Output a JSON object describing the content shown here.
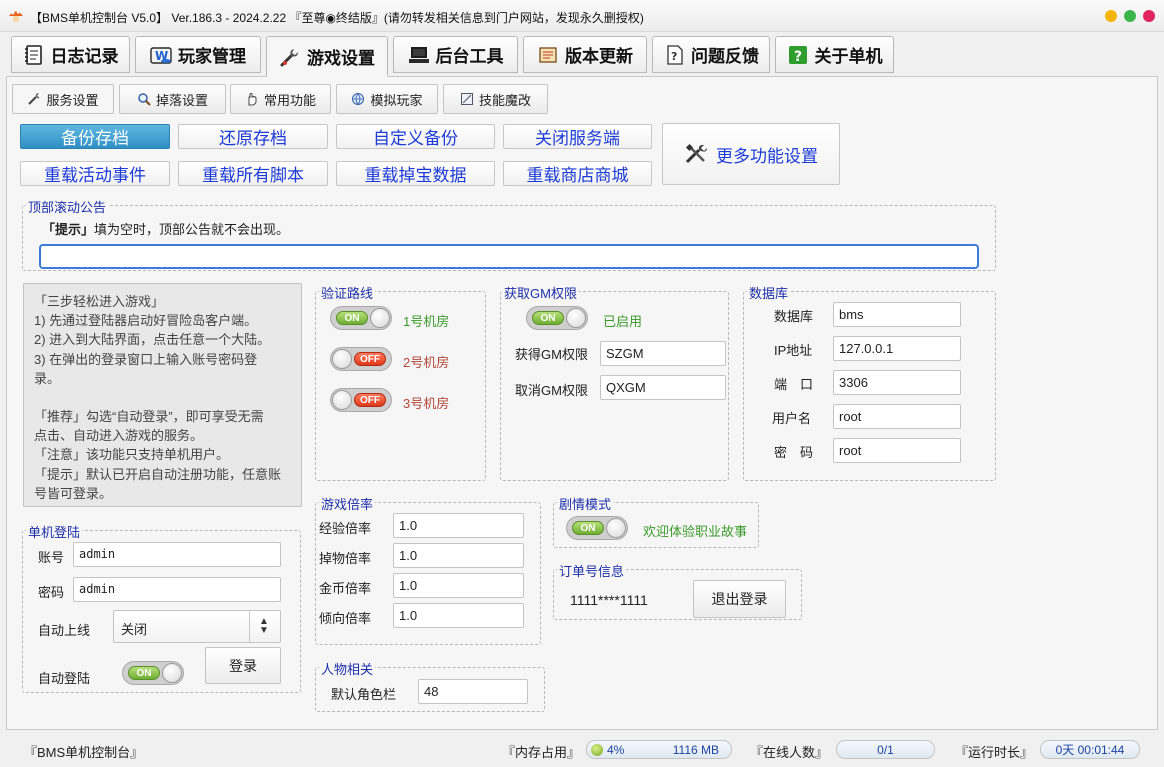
{
  "window": {
    "title": "【BMS单机控制台 V5.0】 Ver.186.3 - 2024.2.22 『至尊◉终结版』(请勿转发相关信息到门户网站，发现永久删授权)",
    "traffic_colors": [
      "#f5b400",
      "#3cb54a",
      "#e0245e"
    ]
  },
  "main_tabs": [
    {
      "label": "日志记录",
      "icon": "notebook-icon"
    },
    {
      "label": "玩家管理",
      "icon": "web-player-icon"
    },
    {
      "label": "游戏设置",
      "icon": "wrench-icon",
      "active": true
    },
    {
      "label": "后台工具",
      "icon": "computer-icon"
    },
    {
      "label": "版本更新",
      "icon": "scroll-icon"
    },
    {
      "label": "问题反馈",
      "icon": "question-paper-icon"
    },
    {
      "label": "关于单机",
      "icon": "help-box-icon"
    }
  ],
  "sub_tabs": [
    {
      "label": "服务设置",
      "icon": "tools-icon",
      "active": true
    },
    {
      "label": "掉落设置",
      "icon": "magnifier-icon"
    },
    {
      "label": "常用功能",
      "icon": "hand-icon"
    },
    {
      "label": "模拟玩家",
      "icon": "globe-icon"
    },
    {
      "label": "技能魔改",
      "icon": "skill-icon"
    }
  ],
  "actions": {
    "row1": [
      "备份存档",
      "还原存档",
      "自定义备份",
      "关闭服务端"
    ],
    "row2": [
      "重载活动事件",
      "重载所有脚本",
      "重载掉宝数据",
      "重载商店商城"
    ],
    "more": "更多功能设置"
  },
  "announcement": {
    "label": "顶部滚动公告",
    "hint_tag": "「提示」",
    "hint_text": "填为空时，顶部公告就不会出现。",
    "value": ""
  },
  "guide": {
    "lines": [
      "「三步轻松进入游戏」",
      "1) 先通过登陆器启动好冒险岛客户端。",
      "2) 进入到大陆界面，点击任意一个大陆。",
      "3) 在弹出的登录窗口上输入账号密码登",
      "录。",
      "",
      "「推荐」勾选“自动登录”，即可享受无需",
      "点击、自动进入游戏的服务。",
      "「注意」该功能只支持单机用户。",
      "「提示」默认已开启自动注册功能，任意账",
      "号皆可登录。"
    ]
  },
  "login": {
    "label": "单机登陆",
    "account_label": "账号",
    "account": "admin",
    "password_label": "密码",
    "password": "admin",
    "auto_online_label": "自动上线",
    "auto_online": "关闭",
    "auto_login_label": "自动登陆",
    "auto_login_toggle": "ON",
    "login_button": "登录"
  },
  "routes": {
    "label": "验证路线",
    "items": [
      {
        "toggle": "ON",
        "label": "1号机房",
        "on": true
      },
      {
        "toggle": "OFF",
        "label": "2号机房",
        "on": false
      },
      {
        "toggle": "OFF",
        "label": "3号机房",
        "on": false
      }
    ]
  },
  "gm": {
    "label": "获取GM权限",
    "toggle": "ON",
    "status": "已启用",
    "get_label": "获得GM权限",
    "get_value": "SZGM",
    "cancel_label": "取消GM权限",
    "cancel_value": "QXGM"
  },
  "database": {
    "label": "数据库",
    "fields": [
      {
        "label": "数据库",
        "value": "bms"
      },
      {
        "label": "IP地址",
        "value": "127.0.0.1"
      },
      {
        "label": "端　口",
        "value": "3306"
      },
      {
        "label": "用户名",
        "value": "root"
      },
      {
        "label": "密　码",
        "value": "root"
      }
    ]
  },
  "rates": {
    "label": "游戏倍率",
    "fields": [
      {
        "label": "经验倍率",
        "value": "1.0"
      },
      {
        "label": "掉物倍率",
        "value": "1.0"
      },
      {
        "label": "金币倍率",
        "value": "1.0"
      },
      {
        "label": "倾向倍率",
        "value": "1.0"
      }
    ]
  },
  "story": {
    "label": "剧情模式",
    "toggle": "ON",
    "text": "欢迎体验职业故事"
  },
  "order": {
    "label": "订单号信息",
    "number": "1111****1111",
    "logout": "退出登录"
  },
  "character": {
    "label": "人物相关",
    "slots_label": "默认角色栏",
    "slots": "48"
  },
  "status": {
    "app": "『BMS单机控制台』",
    "mem_label": "『内存占用』",
    "mem_percent": "4%",
    "mem_size": "1116 MB",
    "online_label": "『在线人数』",
    "online": "0/1",
    "uptime_label": "『运行时长』",
    "uptime": "0天 00:01:44"
  }
}
